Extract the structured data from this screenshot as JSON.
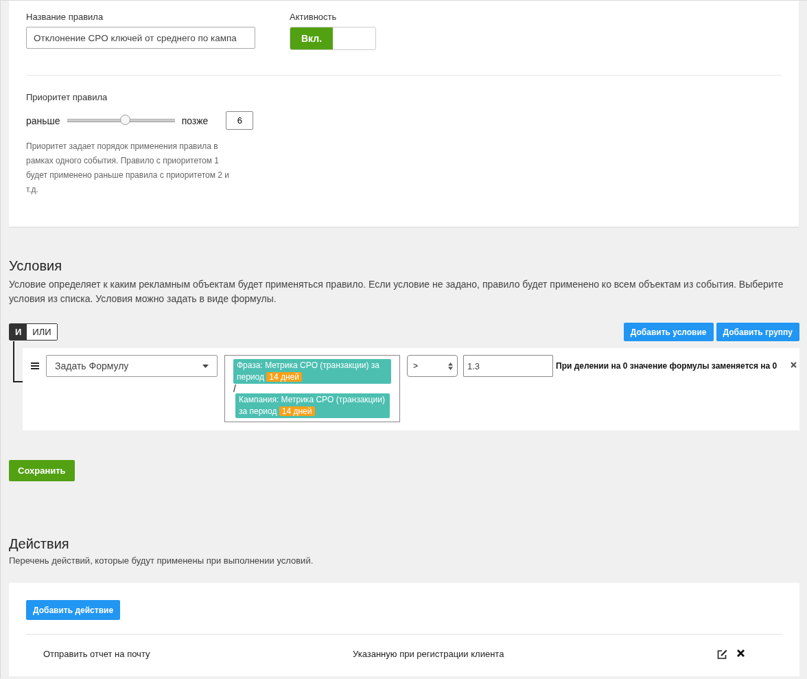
{
  "rule": {
    "name_label": "Название правила",
    "name_value": "Отклонение CPO ключей от среднего по кампа",
    "activity_label": "Активность",
    "activity": {
      "on": true,
      "label": "Вкл."
    },
    "priority_label": "Приоритет правила",
    "earlier": "раньше",
    "later": "позже",
    "priority": {
      "level": 0.54,
      "value": "6"
    },
    "priority_help": "Приоритет задает порядок применения правила в рамках одного события. Правило с приоритетом 1 будет применено раньше правила с приоритетом 2 и т.д."
  },
  "conditions": {
    "title": "Условия",
    "description": "Условие определяет к каким рекламным объектам будет применяться правило. Если условие не задано, правило будет применено ко всем объектам из события. Выберите условия из списка. Условия можно задать в виде формулы.",
    "logic": [
      {
        "label": "И",
        "selected": true
      },
      {
        "label": "ИЛИ",
        "selected": false
      }
    ],
    "buttons": [
      "Добавить условие",
      "Добавить группу"
    ],
    "rows": [
      {
        "type": "Задать Формулу",
        "formula": [
          {
            "text": "Фраза: Метрика CPO (транзакции) за период",
            "badge": "14 дней"
          },
          {
            "text": "Кампания: Метрика CPO (транзакции) за период",
            "badge": "14 дней"
          }
        ],
        "operator_between": "/",
        "comparison": ">",
        "value": "1.3",
        "note": "При делении на 0 значение формулы заменяется на 0"
      }
    ]
  },
  "save_button": "Сохранить",
  "actions": {
    "title": "Действия",
    "description": "Перечень действий, которые будут применены при выполнении условий.",
    "add_button": "Добавить действие",
    "rows": [
      {
        "action": "Отправить отчет на почту",
        "target": "Указанную при регистрации клиента"
      }
    ]
  }
}
